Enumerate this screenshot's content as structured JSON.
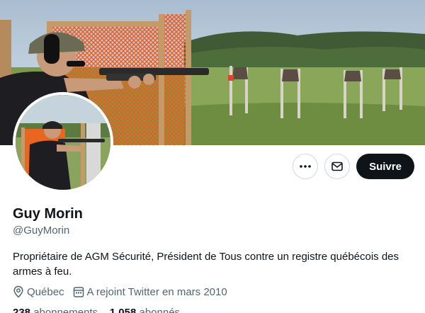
{
  "profile": {
    "name": "Guy Morin",
    "handle": "@GuyMorin",
    "bio": "Propriétaire de AGM Sécurité, Président de Tous contre un registre québécois des armes à feu.",
    "location": "Québec",
    "joined": "A rejoint Twitter en mars 2010"
  },
  "actions": {
    "more_icon": "more-horizontal-icon",
    "message_icon": "envelope-icon",
    "follow_label": "Suivre"
  },
  "stats": {
    "following_count": "238",
    "following_label": "abonnements",
    "followers_count": "1 058",
    "followers_label": "abonnés"
  },
  "colors": {
    "text_primary": "#0f1419",
    "text_secondary": "#536471",
    "follow_button": "#0f1419",
    "border": "#cfd9de"
  }
}
